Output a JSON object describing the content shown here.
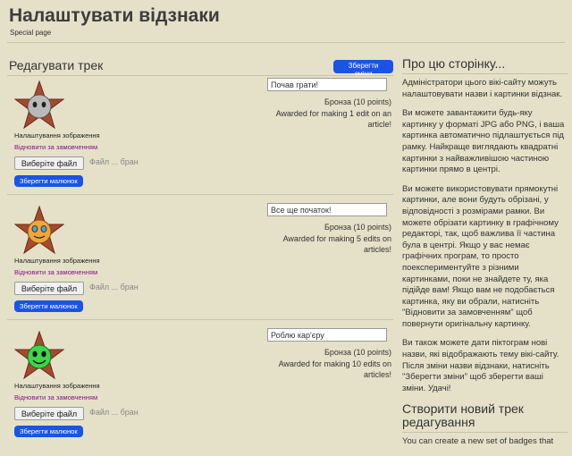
{
  "page": {
    "title": "Налаштувати відзнаки",
    "subtitle": "Special page"
  },
  "edit": {
    "section_title": "Редагувати трек",
    "save_changes": "Зберегти зміни"
  },
  "badges": [
    {
      "name_value": "Почав грати!",
      "points": "Бронза (10 points)",
      "description": "Awarded for making 1 edit on an article!",
      "image_label": "Налаштування зображення",
      "revert_label": "Відновити за замовченням",
      "choose_file": "Виберіте файл",
      "no_file": "Файл ... бран",
      "save_image": "Зберегти малюнок",
      "icon": "grey-face-star-icon",
      "face_color": "#b9b9b9"
    },
    {
      "name_value": "Все ще початок!",
      "points": "Бронза (10 points)",
      "description": "Awarded for making 5 edits on articles!",
      "image_label": "Налаштування зображення",
      "revert_label": "Відновити за замовченням",
      "choose_file": "Виберіте файл",
      "no_file": "Файл ... бран",
      "save_image": "Зберегти малюнок",
      "icon": "orange-face-star-icon",
      "face_color": "#f0a73a"
    },
    {
      "name_value": "Роблю кар'єру",
      "points": "Бронза (10 points)",
      "description": "Awarded for making 10 edits on articles!",
      "image_label": "Налаштування зображення",
      "revert_label": "Відновити за замовченням",
      "choose_file": "Виберіте файл",
      "no_file": "Файл ... бран",
      "save_image": "Зберегти малюнок",
      "icon": "green-face-star-icon",
      "face_color": "#3fd64a"
    }
  ],
  "sidebar": {
    "about_title": "Про цю сторінку...",
    "paragraphs": [
      "Адміністратори цього вікі-сайту можуть налаштовувати назви і картинки відзнак.",
      "Ви можете завантажити будь-яку картинку у форматі JPG або PNG, і ваша картинка автоматично підлаштується під рамку. Найкраще виглядають квадратні картинки з найважливішою частиною картинки прямо в центрі.",
      "Ви можете використовувати прямокутні картинки, але вони будуть обрізані, у відповідності з розмірами рамки. Ви можете обрізати картинку в графічному редакторі, так, щоб важлива її частина була в центрі. Якщо у вас немає графічних програм, то просто поекспериментуйте з різними картинками, поки не знайдете ту, яка підійде вам! Якщо вам не подобається картинка, яку ви обрали, натисніть \"Відновити за замовченням\" щоб повернути оригінальну картинку.",
      "Ви також можете дати піктограм нові назви, які відображають тему вікі-сайту. Після зміни назви відзнаки, натисніть \"Зберегти зміни\" щоб зберегти ваші зміни. Удачі!"
    ],
    "create_title": "Створити новий трек редагування",
    "create_text": "You can create a new set of badges that"
  },
  "colors": {
    "background": "#e4e1c8",
    "button_blue": "#1a53e6",
    "revert_link": "#8a0f8a",
    "star_bronze": "#a44a2e"
  }
}
